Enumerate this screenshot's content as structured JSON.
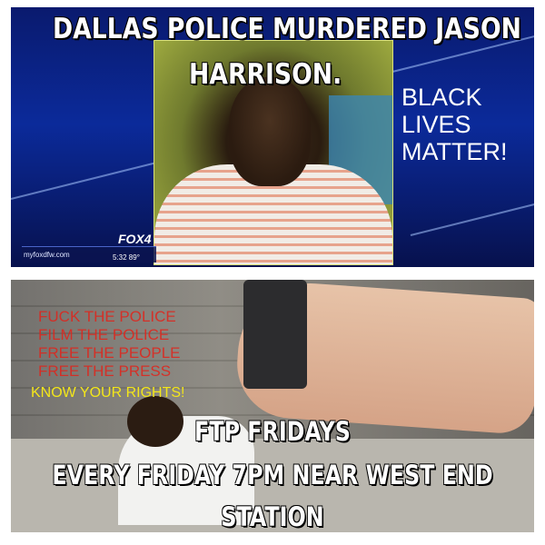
{
  "top_panel": {
    "headline_line1": "DALLAS POLICE MURDERED JASON",
    "headline_line2": "HARRISON.",
    "side_text": [
      "BLACK",
      "LIVES",
      "MATTER!"
    ],
    "broadcast": {
      "logo": "FOX4",
      "site": "myfoxdfw.com",
      "time_temp": "5:32   89°"
    }
  },
  "bottom_panel": {
    "red_lines": [
      "FUCK THE POLICE",
      "FILM THE POLICE",
      "FREE THE PEOPLE",
      "FREE THE PRESS"
    ],
    "rights_line": "KNOW YOUR RIGHTS!",
    "caption": [
      "FTP FRIDAYS",
      "EVERY FRIDAY 7PM NEAR WEST END",
      "STATION"
    ]
  },
  "colors": {
    "headline": "#ffffff",
    "red_text": "#e2231a",
    "rights_text": "#f3e61a",
    "news_blue": "#0b2a9a"
  }
}
